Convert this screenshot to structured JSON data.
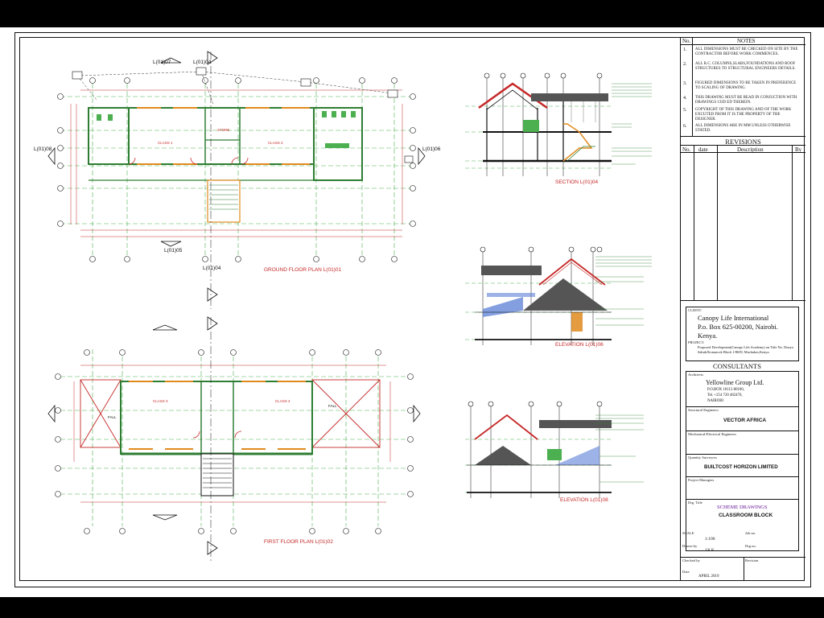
{
  "plans": {
    "ground_floor_title": "GROUND FLOOR PLAN L(01)01",
    "first_floor_title": "FIRST FLOOR PLAN L(01)02",
    "section_title": "SECTION L(01)04",
    "elevation1_title": "ELEVATION L(01)06",
    "elevation2_title": "ELEVATION L(01)08",
    "refs": {
      "l0107_top": "L(01)07",
      "l0104_top": "L(01)04",
      "l0108": "L(01)08",
      "l0106": "L(01)06",
      "l0105": "L(01)05",
      "l0104_bottom": "L(01)04"
    },
    "rooms": {
      "class1": "CLASS 1",
      "class2": "CLASS 2",
      "class3": "CLASS 3",
      "class4": "CLASS 4",
      "store": "STORE",
      "ceramic_tiles": "Ceramic tiles",
      "fall": "FALL"
    }
  },
  "notes": {
    "no_label": "No.",
    "title": "NOTES",
    "items": [
      {
        "n": "1.",
        "text": "ALL DIMENSIONS MUST BE CHECKED ON SITE BY THE CONTRACTOR BEFORE WORK COMMENCES."
      },
      {
        "n": "2.",
        "text": "ALL R.C. COLUMNS,SLABS,FOUNDATIONS AND ROOF STRUCTURES TO STRUCTURAL ENGINEERS DETAILS."
      },
      {
        "n": "3.",
        "text": "FIGURED DIMENSIONS TO BE TAKEN IN PREFERENCE TO SCALING OF DRAWING."
      },
      {
        "n": "4.",
        "text": "THIS DRAWING MUST BE READ IN CONJUCTION WITH DRAWINGS COD ED THEREIN."
      },
      {
        "n": "5.",
        "text": "COPYRIGHT OF THIS DRAWING AND OF THE WORK EXCUTED FROM IT IS THE PROPERTY OF THE DESIGNER."
      },
      {
        "n": "6.",
        "text": "ALL DIMENSIONS ARE IN MM UNLESS OTHERWISE STATED."
      }
    ]
  },
  "revisions": {
    "title": "REVISIONS",
    "col_no": "No.",
    "col_date": "date",
    "col_desc": "Description",
    "col_by": "By"
  },
  "client": {
    "label": "CLIENT:",
    "line1": "Canopy Life International",
    "line2": "P.o. Box 625-00200, Nairobi.",
    "line3": "Kenya.",
    "project_label": "PROJECT:",
    "project_text": "Proposed Development(Canopy Life Academy) on Title No. Donyo Sabuk/Komarock Block 1/8659, Machakos,Kenya."
  },
  "consultants": {
    "title": "CONSULTANTS",
    "architects_label": "Architects",
    "architect_name": "Yellowline Group Ltd.",
    "architect_box": "P.O.BOX 18115-00100,",
    "architect_tel": "Tel. +254 720 482470,",
    "architect_city": "NAIROBI",
    "structural_label": "Structural Engineers",
    "structural_name": "VECTOR AFRICA",
    "mech_label": "Mechanical/Electrical Engineers",
    "qs_label": "Quantity Surveyors",
    "qs_name": "BUILTCOST HORIZON LIMITED",
    "pm_label": "Project Managers"
  },
  "drawing": {
    "title_label": "Drg. Title",
    "title1": "SCHEME DRAWINGS",
    "title2": "CLASSROOM BLOCK",
    "scale_label": "SCALE",
    "scale_value": "1:100",
    "job_label": "Job no.",
    "drawn_label": "Drawn by",
    "drawn_value": "J.K.K.",
    "drg_label": "Drg no.",
    "checked_label": "Checked by",
    "revision_label": "Revision",
    "date_label": "Date",
    "date_value": "APRIL 2019"
  },
  "colors": {
    "wall": "#2e7d32",
    "roof": "#c62828",
    "grid": "#4caf50",
    "accent_purple": "#6a1b9a",
    "orange": "#e08a1e"
  }
}
